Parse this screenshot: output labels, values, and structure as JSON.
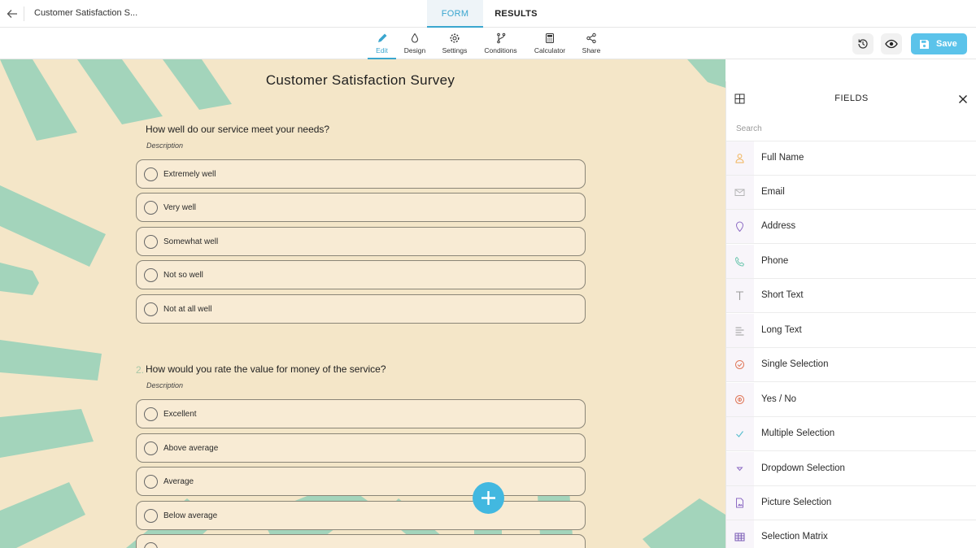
{
  "header": {
    "doc_title": "Customer Satisfaction S...",
    "tabs": [
      {
        "label": "FORM",
        "active": true
      },
      {
        "label": "RESULTS",
        "active": false
      }
    ]
  },
  "toolbar": {
    "items": [
      {
        "label": "Edit",
        "icon": "pencil-icon",
        "active": true
      },
      {
        "label": "Design",
        "icon": "droplet-icon"
      },
      {
        "label": "Settings",
        "icon": "gear-icon"
      },
      {
        "label": "Conditions",
        "icon": "branch-icon"
      },
      {
        "label": "Calculator",
        "icon": "calculator-icon"
      },
      {
        "label": "Share",
        "icon": "share-icon"
      }
    ],
    "save_label": "Save",
    "accent": "#3aa6cf",
    "save_color": "#5bc3ea"
  },
  "survey": {
    "title": "Customer Satisfaction Survey",
    "questions": [
      {
        "number": "",
        "text": "How well do our service meet your needs?",
        "description": "Description",
        "options": [
          "Extremely well",
          "Very well",
          "Somewhat well",
          "Not so well",
          "Not at all well"
        ]
      },
      {
        "number": "2.",
        "text": "How would you rate the value for money of the service?",
        "description": "Description",
        "options": [
          "Excellent",
          "Above average",
          "Average",
          "Below average",
          ""
        ]
      }
    ],
    "bg_color": "#f4e6c8",
    "stripe_color": "#a3d4bb"
  },
  "panel": {
    "title": "FIELDS",
    "search_placeholder": "Search",
    "fields": [
      {
        "label": "Full Name",
        "icon": "person-icon",
        "color": "#f0b45a"
      },
      {
        "label": "Email",
        "icon": "envelope-icon",
        "color": "#b5b5b5"
      },
      {
        "label": "Address",
        "icon": "map-pin-icon",
        "color": "#8d6bc4"
      },
      {
        "label": "Phone",
        "icon": "phone-icon",
        "color": "#6fc7b0"
      },
      {
        "label": "Short Text",
        "icon": "text-t-icon",
        "color": "#9a9a9a"
      },
      {
        "label": "Long Text",
        "icon": "paragraph-icon",
        "color": "#9a9a9a"
      },
      {
        "label": "Single Selection",
        "icon": "check-circle-icon",
        "color": "#e0785a"
      },
      {
        "label": "Yes / No",
        "icon": "yes-no-icon",
        "color": "#e0785a"
      },
      {
        "label": "Multiple Selection",
        "icon": "checkmark-icon",
        "color": "#5bbfcf"
      },
      {
        "label": "Dropdown Selection",
        "icon": "dropdown-icon",
        "color": "#8d6bc4"
      },
      {
        "label": "Picture Selection",
        "icon": "picture-file-icon",
        "color": "#8d6bc4"
      },
      {
        "label": "Selection Matrix",
        "icon": "matrix-icon",
        "color": "#7a5bb5"
      }
    ]
  }
}
